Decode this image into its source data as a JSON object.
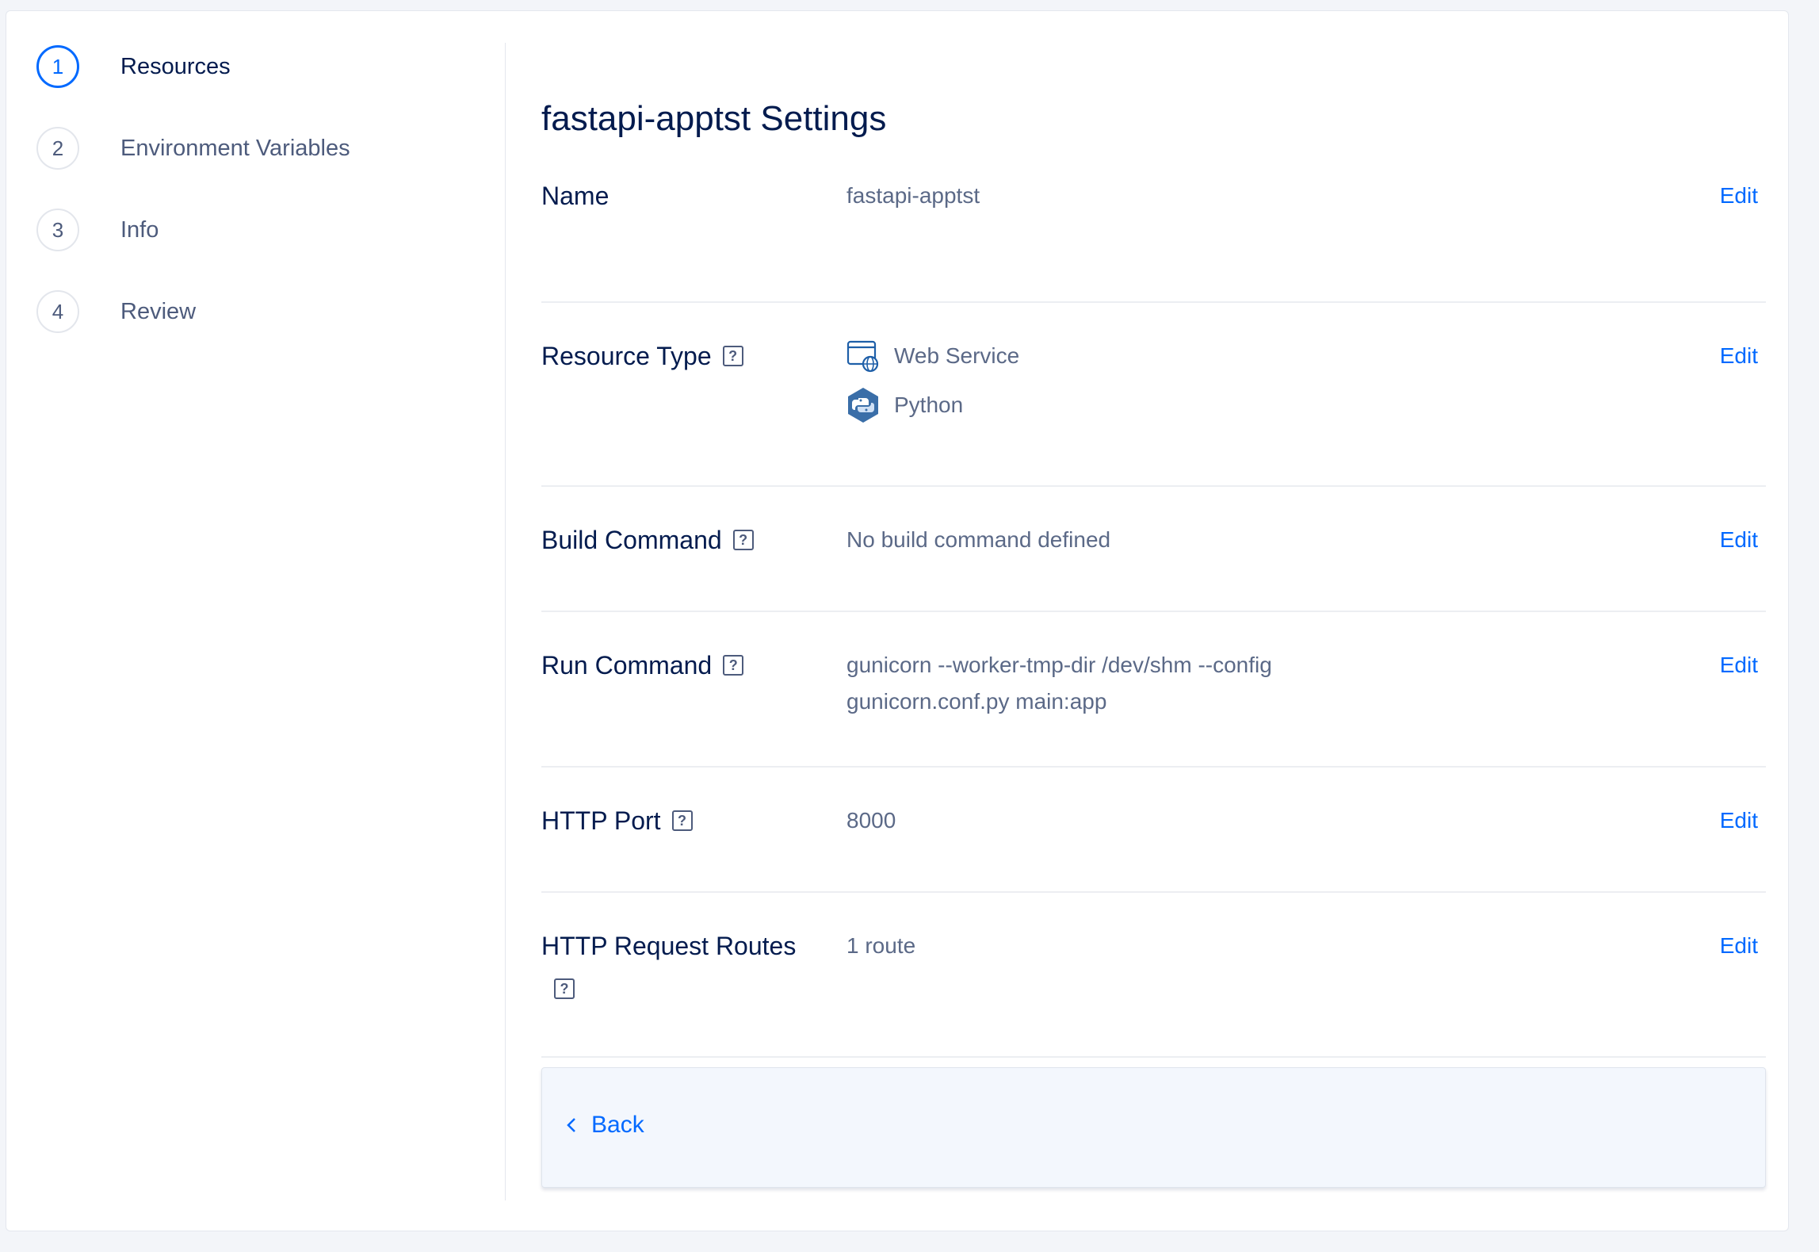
{
  "stepper": {
    "steps": [
      {
        "number": "1",
        "label": "Resources",
        "active": true
      },
      {
        "number": "2",
        "label": "Environment Variables",
        "active": false
      },
      {
        "number": "3",
        "label": "Info",
        "active": false
      },
      {
        "number": "4",
        "label": "Review",
        "active": false
      }
    ]
  },
  "main": {
    "title": "fastapi-apptst Settings",
    "edit_label": "Edit",
    "help_glyph": "?",
    "rows": {
      "name": {
        "label": "Name",
        "value": "fastapi-apptst"
      },
      "resource_type": {
        "label": "Resource Type",
        "type": "Web Service",
        "runtime": "Python"
      },
      "build_command": {
        "label": "Build Command",
        "value": "No build command defined"
      },
      "run_command": {
        "label": "Run Command",
        "line1": "gunicorn --worker-tmp-dir /dev/shm --config",
        "line2": "gunicorn.conf.py main:app"
      },
      "http_port": {
        "label": "HTTP Port",
        "value": "8000"
      },
      "http_routes": {
        "label": "HTTP Request Routes",
        "value": "1 route"
      }
    }
  },
  "footer": {
    "back_label": "Back"
  },
  "colors": {
    "accent": "#0069ff",
    "heading": "#031b4e",
    "muted": "#5b6987"
  }
}
